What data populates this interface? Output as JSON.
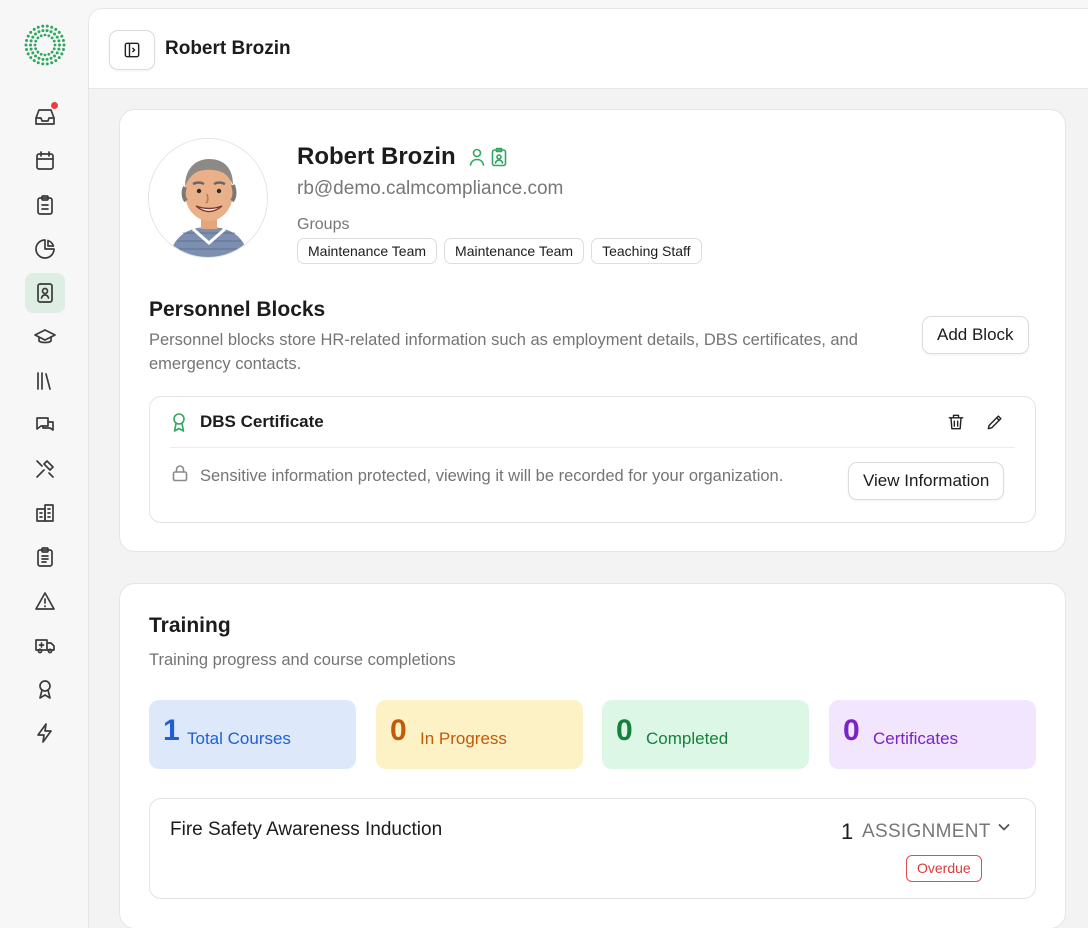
{
  "header": {
    "title": "Robert Brozin"
  },
  "sidebar": {
    "items": [
      {
        "icon": "inbox-icon",
        "active": false,
        "notification": true
      },
      {
        "icon": "calendar-icon",
        "active": false
      },
      {
        "icon": "clipboard-icon",
        "active": false
      },
      {
        "icon": "pie-chart-icon",
        "active": false
      },
      {
        "icon": "contact-book-icon",
        "active": true
      },
      {
        "icon": "graduation-cap-icon",
        "active": false
      },
      {
        "icon": "library-icon",
        "active": false
      },
      {
        "icon": "messages-icon",
        "active": false
      },
      {
        "icon": "tools-icon",
        "active": false
      },
      {
        "icon": "building-icon",
        "active": false
      },
      {
        "icon": "clipboard-list-icon",
        "active": false
      },
      {
        "icon": "warning-icon",
        "active": false
      },
      {
        "icon": "ambulance-icon",
        "active": false
      },
      {
        "icon": "award-icon",
        "active": false
      },
      {
        "icon": "lightning-icon",
        "active": false
      }
    ]
  },
  "profile": {
    "name": "Robert Brozin",
    "email": "rb@demo.calmcompliance.com",
    "groups_label": "Groups",
    "groups": [
      "Maintenance Team",
      "Maintenance Team",
      "Teaching Staff"
    ]
  },
  "personnel": {
    "title": "Personnel Blocks",
    "description": "Personnel blocks store HR-related information such as employment details, DBS certificates, and emergency contacts.",
    "add_label": "Add Block",
    "block": {
      "title": "DBS Certificate",
      "sensitive_text": "Sensitive information protected, viewing it will be recorded for your organization.",
      "view_label": "View Information"
    }
  },
  "training": {
    "title": "Training",
    "description": "Training progress and course completions",
    "stats": [
      {
        "value": "1",
        "label": "Total Courses",
        "bg": "#dde9fb",
        "color": "#1f5fd6"
      },
      {
        "value": "0",
        "label": "In Progress",
        "bg": "#fdf1c6",
        "color": "#c25a0c"
      },
      {
        "value": "0",
        "label": "Completed",
        "bg": "#dcf7e6",
        "color": "#16803e"
      },
      {
        "value": "0",
        "label": "Certificates",
        "bg": "#f1e6fd",
        "color": "#7b22c9"
      }
    ],
    "course": {
      "title": "Fire Safety Awareness Induction",
      "count": "1",
      "assignment_label": "ASSIGNMENT",
      "status": "Overdue"
    }
  },
  "colors": {
    "accent": "#2fa760",
    "danger": "#e24b4b"
  }
}
